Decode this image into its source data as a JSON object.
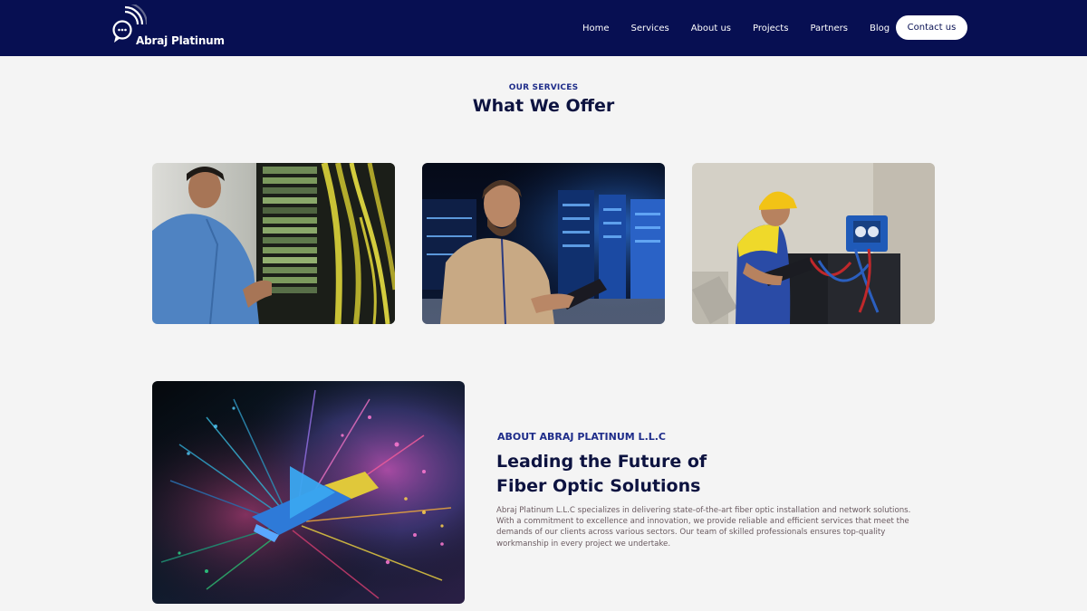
{
  "brand": {
    "name": "Abraj Platinum"
  },
  "nav": {
    "items": [
      {
        "label": "Home"
      },
      {
        "label": "Services"
      },
      {
        "label": "About us"
      },
      {
        "label": "Projects"
      },
      {
        "label": "Partners"
      },
      {
        "label": "Blog"
      }
    ],
    "cta_label": "Contact us"
  },
  "services": {
    "eyebrow": "OUR SERVICES",
    "title": "What We Offer",
    "cards": [
      {
        "image": "technician-fiber-patch-panel-photo"
      },
      {
        "image": "engineer-server-room-tablet-photo"
      },
      {
        "image": "worker-hardhat-equipment-photo"
      }
    ]
  },
  "about": {
    "video_image": "fiber-optic-cable-light-photo",
    "play_icon": "play-icon",
    "eyebrow": "ABOUT ABRAJ PLATINUM L.L.C",
    "title_line1": "Leading the Future of",
    "title_line2": "Fiber Optic Solutions",
    "body": "Abraj Platinum L.L.C specializes in delivering state-of-the-art fiber optic installation and network solutions. With a commitment to excellence and innovation, we provide reliable and efficient services that meet the demands of our clients across various sectors. Our team of skilled professionals ensures top-quality workmanship in every project we undertake."
  },
  "colors": {
    "navbar": "#070f52",
    "accent": "#1f2d8a",
    "heading": "#0d1340",
    "background": "#f4f4f4"
  }
}
